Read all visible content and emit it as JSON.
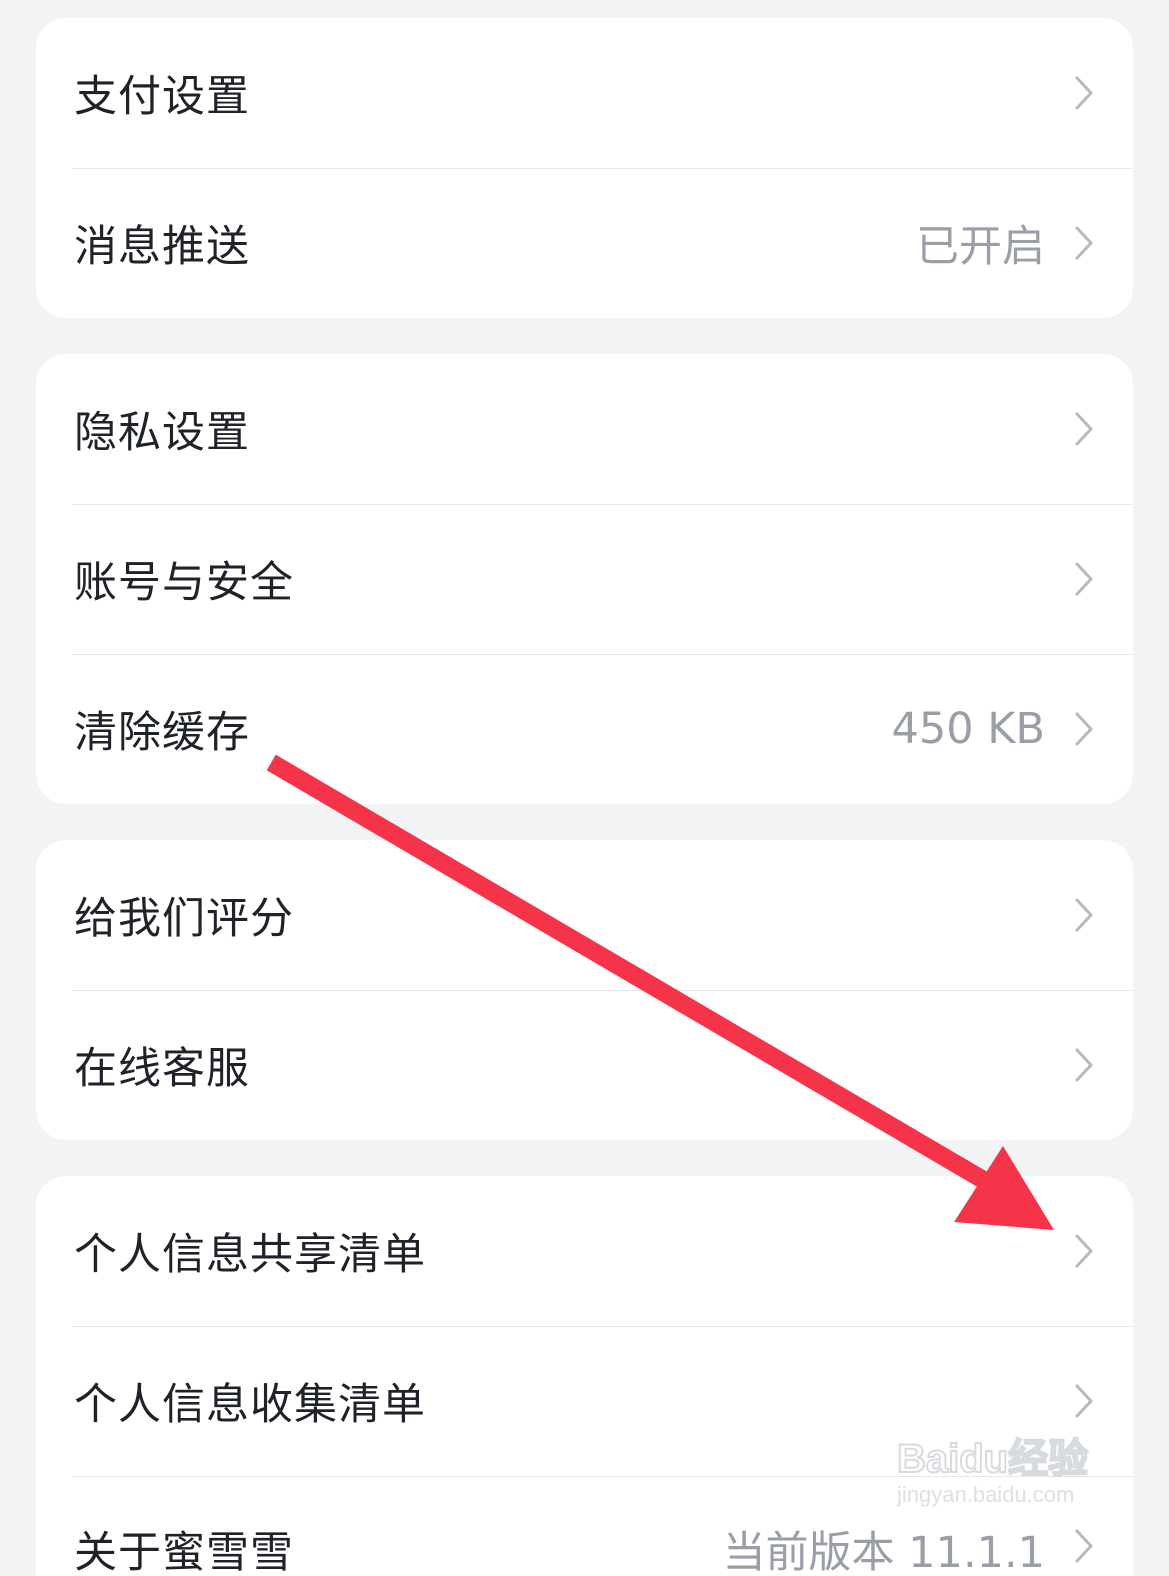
{
  "groups": [
    {
      "items": [
        {
          "label": "支付设置",
          "value": ""
        },
        {
          "label": "消息推送",
          "value": "已开启"
        }
      ]
    },
    {
      "items": [
        {
          "label": "隐私设置",
          "value": ""
        },
        {
          "label": "账号与安全",
          "value": ""
        },
        {
          "label": "清除缓存",
          "value": "450 KB"
        }
      ]
    },
    {
      "items": [
        {
          "label": "给我们评分",
          "value": ""
        },
        {
          "label": "在线客服",
          "value": ""
        }
      ]
    },
    {
      "items": [
        {
          "label": "个人信息共享清单",
          "value": ""
        },
        {
          "label": "个人信息收集清单",
          "value": ""
        },
        {
          "label": "关于蜜雪雪",
          "value": "当前版本 11.1.1"
        }
      ]
    }
  ],
  "icons": {
    "chevron": "chevron-right-icon",
    "annotation": "red-arrow-annotation"
  },
  "colors": {
    "background": "#f2f3f5",
    "card": "#ffffff",
    "label": "#1f2329",
    "value": "#9a9ea6",
    "chevron": "#b5b9c0",
    "arrow": "#f5344a"
  },
  "watermark": {
    "logo": "Baidu经验",
    "url": "jingyan.baidu.com"
  }
}
